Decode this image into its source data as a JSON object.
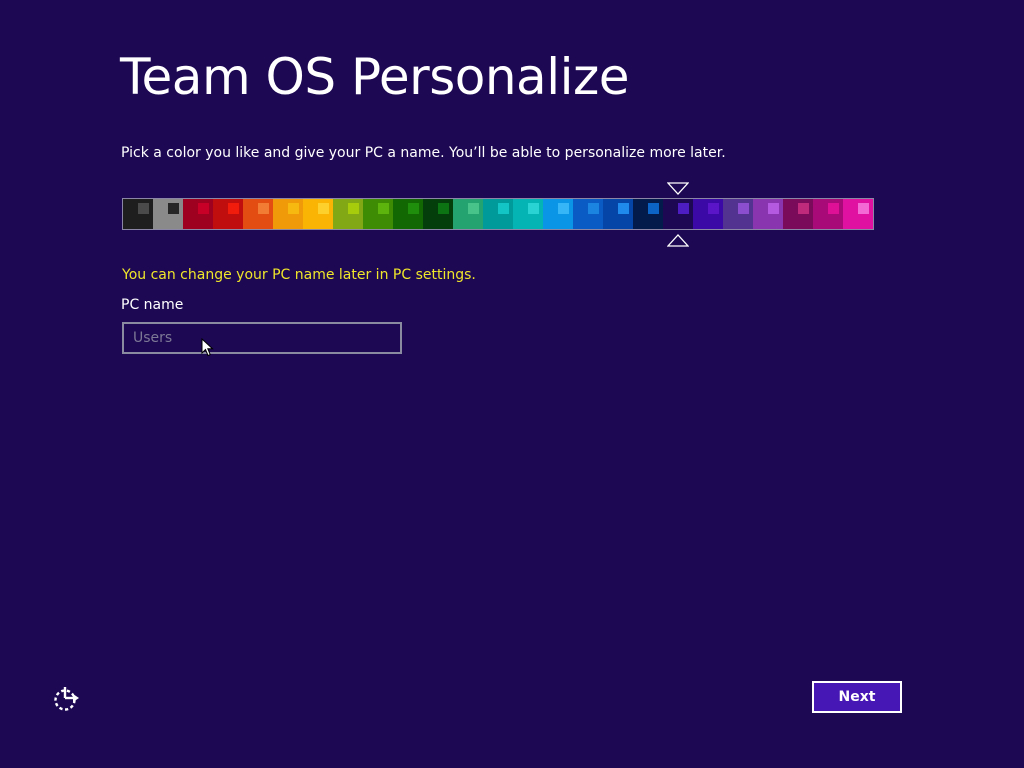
{
  "title": "Team OS Personalize",
  "instruction": "Pick a color you like and give your PC a name. You’ll be able to personalize more later.",
  "palette": {
    "selected_index": 18,
    "swatches": [
      {
        "bg": "#1e1e1e",
        "chip": "#4a4a4a"
      },
      {
        "bg": "#8a8a8a",
        "chip": "#262626"
      },
      {
        "bg": "#9e0020",
        "chip": "#c80028"
      },
      {
        "bg": "#c00d0d",
        "chip": "#f21c0c"
      },
      {
        "bg": "#e44d11",
        "chip": "#f27c33"
      },
      {
        "bg": "#f09a09",
        "chip": "#f7b80f"
      },
      {
        "bg": "#fab404",
        "chip": "#fdd02c"
      },
      {
        "bg": "#82a816",
        "chip": "#a6cc0c"
      },
      {
        "bg": "#3d8c03",
        "chip": "#5cb40c"
      },
      {
        "bg": "#126903",
        "chip": "#1f8e0c"
      },
      {
        "bg": "#043e0a",
        "chip": "#0d7413"
      },
      {
        "bg": "#24a371",
        "chip": "#48c48a"
      },
      {
        "bg": "#009a9a",
        "chip": "#13c5c5"
      },
      {
        "bg": "#04b3b3",
        "chip": "#29d3d3"
      },
      {
        "bg": "#0b95e6",
        "chip": "#36b6f6"
      },
      {
        "bg": "#0a5bc4",
        "chip": "#1b84e0"
      },
      {
        "bg": "#0645a8",
        "chip": "#1f8aeb"
      },
      {
        "bg": "#031b4b",
        "chip": "#0c64c4"
      },
      {
        "bg": "#1d0853",
        "chip": "#4e1dc1"
      },
      {
        "bg": "#3b0aa6",
        "chip": "#5a15c9"
      },
      {
        "bg": "#52338f",
        "chip": "#8a4ecf"
      },
      {
        "bg": "#8a35b0",
        "chip": "#b45ae0"
      },
      {
        "bg": "#7a0a5a",
        "chip": "#bf2a7a"
      },
      {
        "bg": "#a80a78",
        "chip": "#e01096"
      },
      {
        "bg": "#e010a0",
        "chip": "#f36ad4"
      }
    ]
  },
  "hint": "You can change your PC name later in PC settings.",
  "pc_name": {
    "label": "PC name",
    "value": "",
    "placeholder": "Users"
  },
  "next_label": "Next",
  "colors": {
    "background": "#1d0853",
    "hint_text": "#f0e62a",
    "button_bg": "#4617b4"
  },
  "icons": {
    "ease_of_access": "ease-of-access-icon",
    "selection_marker_top": "triangle-down-icon",
    "selection_marker_bottom": "triangle-up-icon",
    "mouse_pointer": "mouse-pointer-icon"
  }
}
